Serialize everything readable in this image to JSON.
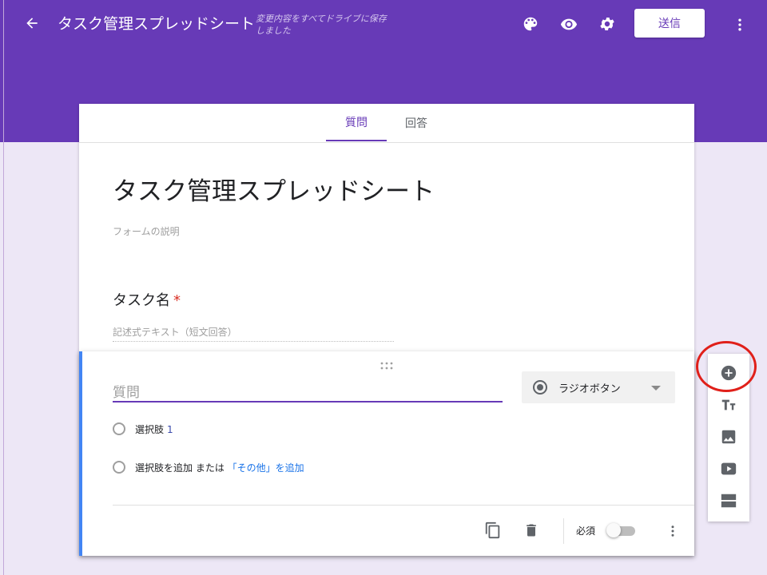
{
  "header": {
    "title": "タスク管理スプレッドシート",
    "save_status": "変更内容をすべてドライブに保存しました",
    "send_label": "送信",
    "icons": [
      "back-arrow-icon",
      "palette-icon",
      "eye-icon",
      "gear-icon",
      "more-vert-icon"
    ]
  },
  "tabs": [
    {
      "label": "質問",
      "active": true
    },
    {
      "label": "回答",
      "active": false
    }
  ],
  "form": {
    "title": "タスク管理スプレッドシート",
    "description_placeholder": "フォームの説明"
  },
  "question1": {
    "title": "タスク名",
    "required_mark": "*",
    "answer_placeholder": "記述式テキスト（短文回答）"
  },
  "question2": {
    "title_placeholder": "質問",
    "type": "ラジオボタン",
    "option1_label": "選択肢",
    "option1_number": "1",
    "add_option": "選択肢を追加",
    "or_text": " または ",
    "add_other": "「その他」を追加",
    "required_label": "必須",
    "required_on": false
  },
  "toolbar": {
    "items": [
      "add-question-icon",
      "title-text-icon",
      "image-icon",
      "video-icon",
      "section-icon"
    ]
  },
  "colors": {
    "brand": "#673ab7",
    "background": "#ede7f6",
    "accent_bar": "#4285f4",
    "annotation": "#e0201a"
  }
}
